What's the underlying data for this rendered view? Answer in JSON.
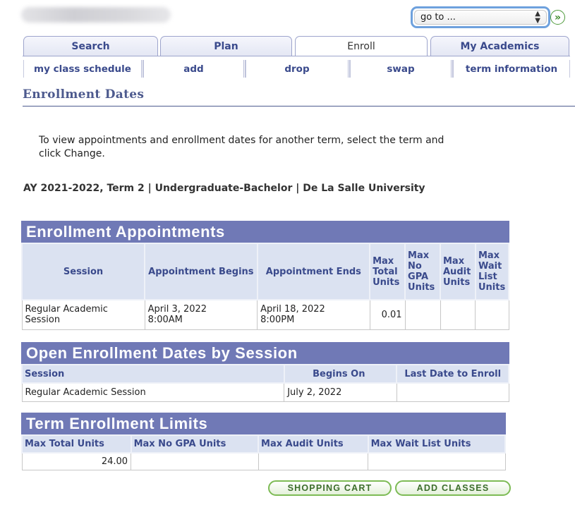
{
  "goto": {
    "label": "go to ..."
  },
  "tabs": [
    {
      "label": "Search"
    },
    {
      "label": "Plan"
    },
    {
      "label": "Enroll"
    },
    {
      "label": "My Academics"
    }
  ],
  "subtabs": [
    {
      "label": "my class schedule"
    },
    {
      "label": "add"
    },
    {
      "label": "drop"
    },
    {
      "label": "swap"
    },
    {
      "label": "term information"
    }
  ],
  "page": {
    "title": "Enrollment Dates",
    "instructions": "To view appointments and enrollment dates for another term, select the term and click Change.",
    "term_line": "AY 2021-2022, Term 2 | Undergraduate-Bachelor | De La Salle University"
  },
  "appointments": {
    "title": "Enrollment Appointments",
    "headers": {
      "session": "Session",
      "begins": "Appointment Begins",
      "ends": "Appointment Ends",
      "max_total": "Max Total Units",
      "max_no_gpa": "Max No GPA Units",
      "max_audit": "Max Audit Units",
      "max_wait": "Max Wait List Units"
    },
    "row": {
      "session": "Regular Academic Session",
      "begins_date": "April 3, 2022",
      "begins_time": "8:00AM",
      "ends_date": "April 18, 2022",
      "ends_time": "8:00PM",
      "max_total": "0.01",
      "max_no_gpa": "",
      "max_audit": "",
      "max_wait": ""
    }
  },
  "open_enrollment": {
    "title": "Open Enrollment Dates by Session",
    "headers": {
      "session": "Session",
      "begins": "Begins On",
      "last": "Last Date to Enroll"
    },
    "row": {
      "session": "Regular Academic Session",
      "begins": "July 2, 2022",
      "last": ""
    }
  },
  "limits": {
    "title": "Term Enrollment Limits",
    "headers": {
      "max_total": "Max Total Units",
      "max_no_gpa": "Max No GPA Units",
      "max_audit": "Max Audit Units",
      "max_wait": "Max Wait List Units"
    },
    "row": {
      "max_total": "24.00",
      "max_no_gpa": "",
      "max_audit": "",
      "max_wait": ""
    }
  },
  "buttons": {
    "shopping_cart": "SHOPPING CART",
    "add_classes": "ADD CLASSES"
  },
  "colors": {
    "grid_title_bg": "#7079b6",
    "grid_header_bg": "#dbe2f1",
    "link_text": "#3a4a8c",
    "button_border": "#7dbb55",
    "focus_ring": "#6ea1dd"
  },
  "icons": {
    "go": "double-chevron-right-icon",
    "select": "up-down-arrows-icon"
  }
}
